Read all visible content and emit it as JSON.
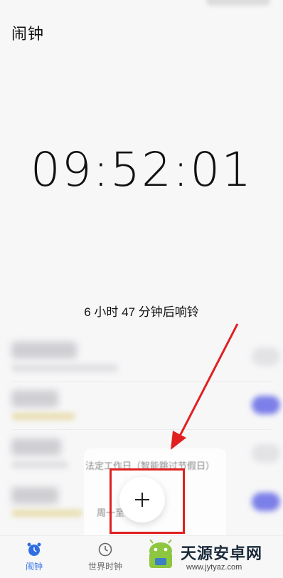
{
  "header": {
    "title": "闹钟"
  },
  "clock": {
    "time": "09:52:01",
    "ring_info": "6 小时 47 分钟后响铃"
  },
  "alarm_list": {
    "rows": [
      {
        "toggle": "off"
      },
      {
        "toggle": "on"
      },
      {
        "toggle": "off"
      },
      {
        "toggle": "on"
      }
    ],
    "toggle_on_color": "#7b7fe8"
  },
  "repeat_popup": {
    "option_workday": "法定工作日（智能跳过节假日）",
    "option_monday": "周一至"
  },
  "add_button": {
    "icon": "plus-icon"
  },
  "annotation": {
    "color": "#e02020"
  },
  "bottom_nav": {
    "tabs": [
      {
        "label": "闹钟",
        "icon": "alarm-clock-icon",
        "active": true,
        "color": "#2f6fe3"
      },
      {
        "label": "世界时钟",
        "icon": "clock-icon",
        "active": false
      }
    ]
  },
  "watermark": {
    "title": "天源安卓网",
    "url": "www.jytyaz.com"
  }
}
